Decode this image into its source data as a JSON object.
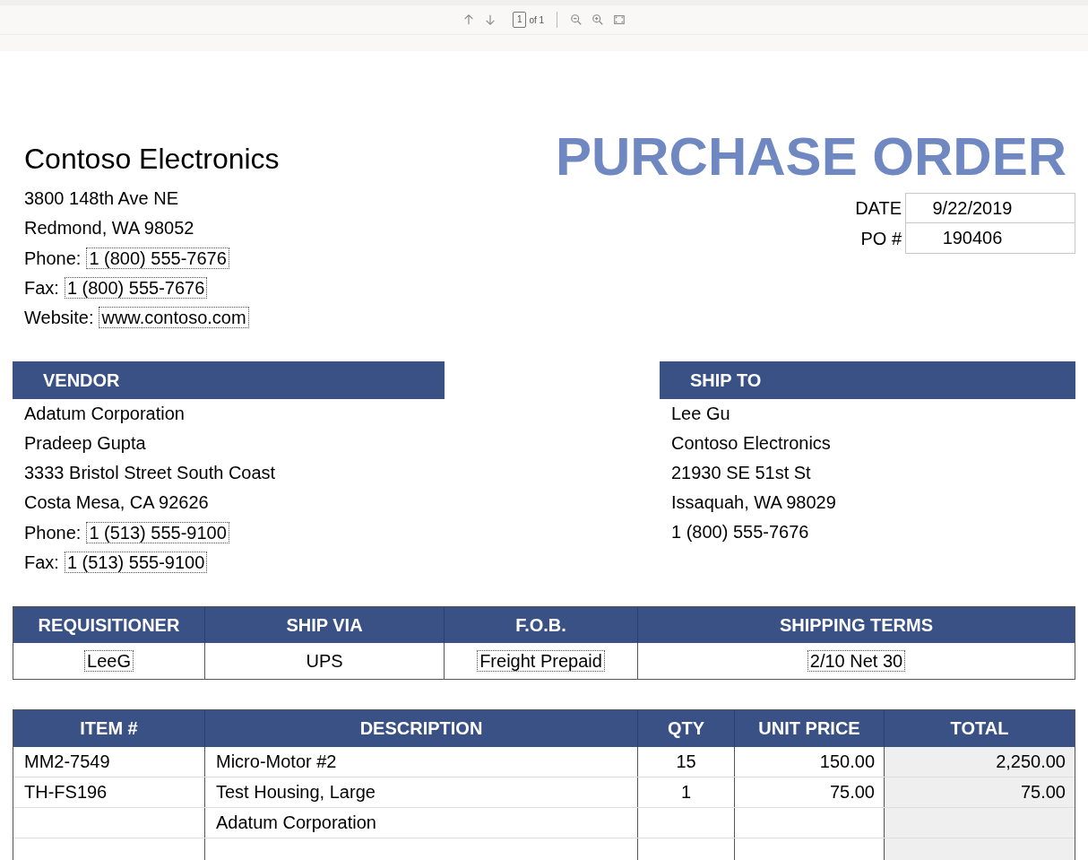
{
  "toolbar": {
    "page_number": "1",
    "page_count": "of 1"
  },
  "company": {
    "name": "Contoso Electronics",
    "address_lines": [
      "3800 148th Ave NE",
      "Redmond, WA 98052"
    ],
    "contacts": [
      {
        "label": "Phone:",
        "value": "1 (800) 555-7676"
      },
      {
        "label": "Fax:",
        "value": "1 (800) 555-7676"
      },
      {
        "label": "Website:",
        "value": "www.contoso.com"
      }
    ]
  },
  "title": "PURCHASE ORDER",
  "meta": [
    {
      "label": "DATE",
      "value": "9/22/2019"
    },
    {
      "label": "PO #",
      "value": "190406"
    }
  ],
  "vendor": {
    "heading": "VENDOR",
    "lines": [
      "Adatum Corporation",
      "Pradeep Gupta",
      "3333 Bristol Street South Coast",
      "Costa Mesa, CA 92626"
    ],
    "contacts": [
      {
        "label": "Phone:",
        "value": "1 (513) 555-9100"
      },
      {
        "label": "Fax:",
        "value": "1 (513) 555-9100"
      }
    ]
  },
  "ship_to": {
    "heading": "SHIP TO",
    "lines": [
      "Lee Gu",
      "Contoso Electronics",
      "21930 SE 51st St",
      "Issaquah, WA 98029",
      "1 (800) 555-7676"
    ]
  },
  "shipping_table": {
    "columns": [
      "REQUISITIONER",
      "SHIP VIA",
      "F.O.B.",
      "SHIPPING TERMS"
    ],
    "values": [
      "LeeG",
      "UPS",
      "Freight Prepaid",
      "2/10 Net 30"
    ]
  },
  "items_table": {
    "columns": [
      "ITEM #",
      "DESCRIPTION",
      "QTY",
      "UNIT PRICE",
      "TOTAL"
    ],
    "rows": [
      [
        "MM2-7549",
        "Micro-Motor #2",
        "15",
        "150.00",
        "2,250.00"
      ],
      [
        "TH-FS196",
        "Test Housing, Large",
        "1",
        "75.00",
        "75.00"
      ],
      [
        "",
        "Adatum Corporation",
        "",
        "",
        ""
      ],
      [
        "",
        "",
        "",
        "",
        ""
      ]
    ]
  }
}
